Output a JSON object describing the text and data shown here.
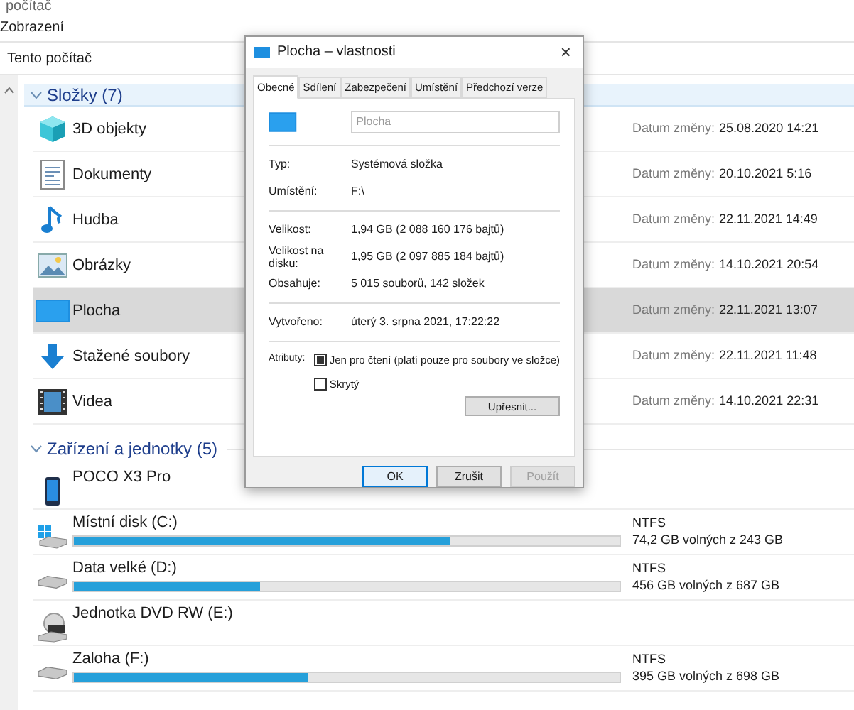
{
  "top_bar": {
    "title": "počítač"
  },
  "menu": {
    "label": "Zobrazení"
  },
  "address_bar": {
    "path": "Tento počítač"
  },
  "folders_group": {
    "title": "Složky (7)",
    "expanded": true,
    "items": [
      {
        "name": "3D objekty",
        "date_label": "Datum změny:",
        "date": "25.08.2020 14:21",
        "selected": false
      },
      {
        "name": "Dokumenty",
        "date_label": "Datum změny:",
        "date": "20.10.2021 5:16",
        "selected": false
      },
      {
        "name": "Hudba",
        "date_label": "Datum změny:",
        "date": "22.11.2021 14:49",
        "selected": false
      },
      {
        "name": "Obrázky",
        "date_label": "Datum změny:",
        "date": "14.10.2021 20:54",
        "selected": false
      },
      {
        "name": "Plocha",
        "date_label": "Datum změny:",
        "date": "22.11.2021 13:07",
        "selected": true
      },
      {
        "name": "Stažené soubory",
        "date_label": "Datum změny:",
        "date": "22.11.2021 11:48",
        "selected": false
      },
      {
        "name": "Videa",
        "date_label": "Datum změny:",
        "date": "14.10.2021 22:31",
        "selected": false
      }
    ]
  },
  "devices_group": {
    "title": "Zařízení a jednotky (5)",
    "expanded": true,
    "items": [
      {
        "kind": "phone",
        "name": "POCO X3 Pro"
      },
      {
        "kind": "disk",
        "name": "Místní disk (C:)",
        "filesystem": "NTFS",
        "free": "74,2 GB volných z 243 GB",
        "level": 0.69
      },
      {
        "kind": "disk",
        "name": "Data velké (D:)",
        "filesystem": "NTFS",
        "free": "456 GB volných z 687 GB",
        "level": 0.34
      },
      {
        "kind": "dvd",
        "name": "Jednotka DVD RW (E:)"
      },
      {
        "kind": "disk",
        "name": "Zaloha (F:)",
        "filesystem": "NTFS",
        "free": "395 GB volných z 698 GB",
        "level": 0.43
      }
    ]
  },
  "dialog": {
    "title": "Plocha – vlastnosti",
    "close": "×",
    "tabs": [
      {
        "label": "Obecné",
        "selected": true
      },
      {
        "label": "Sdílení",
        "selected": false
      },
      {
        "label": "Zabezpečení",
        "selected": false
      },
      {
        "label": "Umístění",
        "selected": false
      },
      {
        "label": "Předchozí verze",
        "selected": false
      }
    ],
    "name_field": {
      "placeholder": "Plocha"
    },
    "info": [
      {
        "label": "Typ:",
        "value": "Systémová složka"
      },
      {
        "label": "Umístění:",
        "value": "F:\\"
      }
    ],
    "size": [
      {
        "label": "Velikost:",
        "value": "1,94 GB (2 088 160 176 bajtů)"
      },
      {
        "label": "Velikost na disku:",
        "value": "1,95 GB (2 097 885 184 bajtů)"
      },
      {
        "label": "Obsahuje:",
        "value": "5 015 souborů, 142 složek"
      }
    ],
    "created": {
      "label": "Vytvořeno:",
      "value": "úterý 3. srpna 2021, 17:22:22"
    },
    "attributes": {
      "label": "Atributy:",
      "options": [
        {
          "label": "Jen pro čtení (platí pouze pro soubory ve složce)",
          "checked": true
        },
        {
          "label": "Skrytý",
          "checked": false
        }
      ],
      "advanced": "Upřesnit..."
    },
    "buttons": [
      {
        "label": "OK",
        "default": true,
        "disabled": false
      },
      {
        "label": "Zrušit",
        "default": false,
        "disabled": false
      },
      {
        "label": "Použít",
        "default": false,
        "disabled": true
      }
    ]
  }
}
